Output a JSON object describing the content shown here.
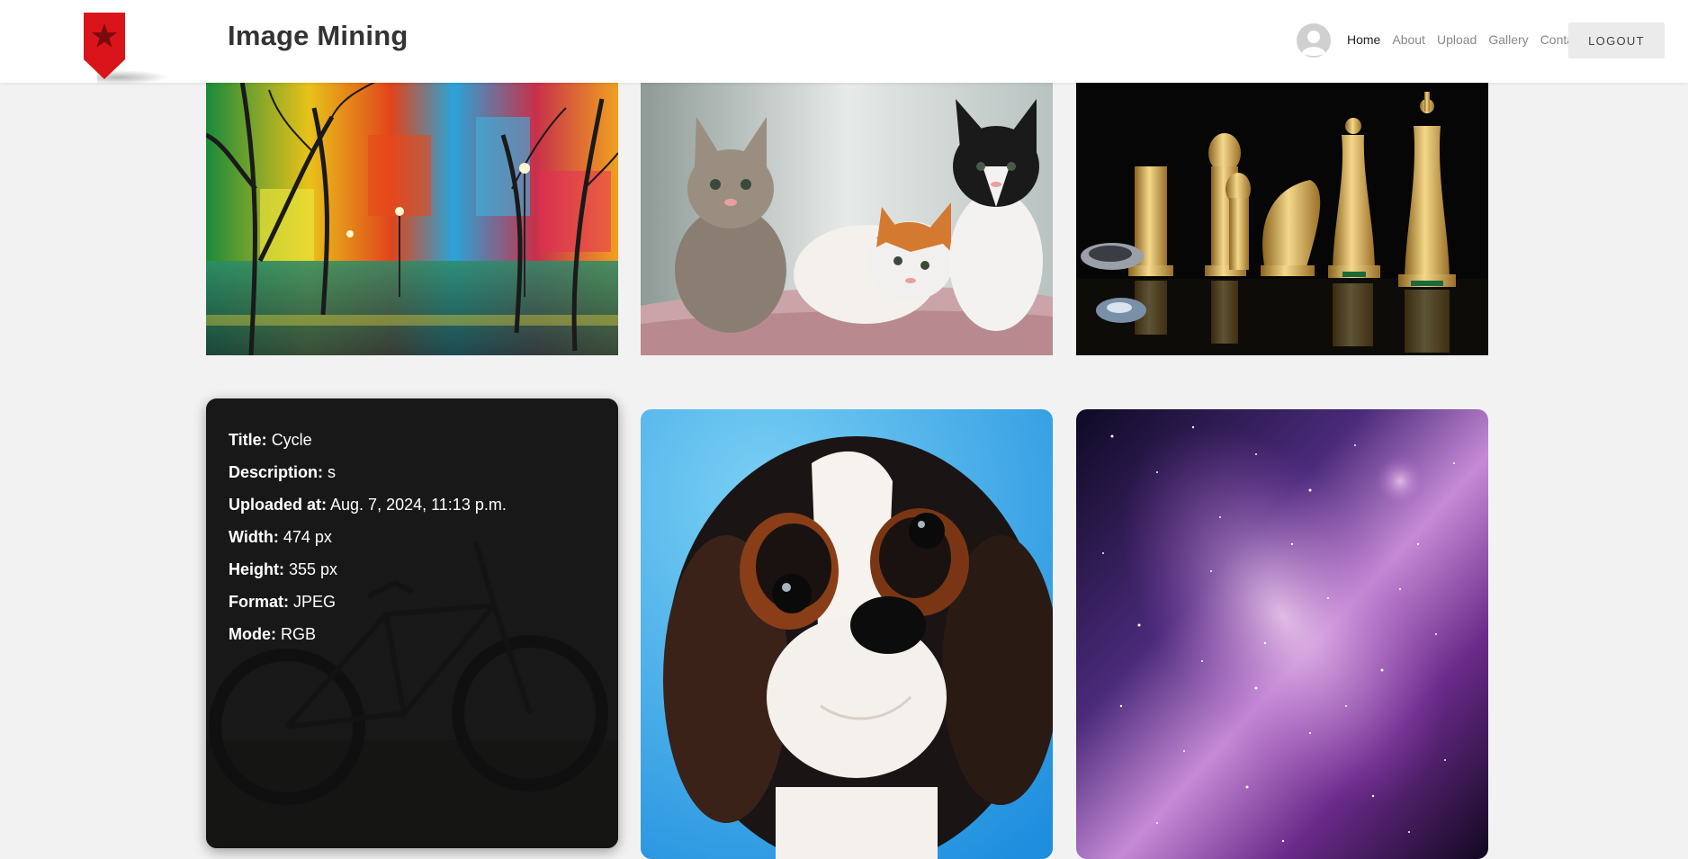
{
  "header": {
    "title": "Image Mining",
    "logo_icon": "bookmark-star-icon",
    "avatar_icon": "user-avatar-icon",
    "nav": [
      {
        "label": "Home",
        "active": true
      },
      {
        "label": "About",
        "active": false
      },
      {
        "label": "Upload",
        "active": false
      },
      {
        "label": "Gallery",
        "active": false
      },
      {
        "label": "Contact",
        "active": false
      }
    ],
    "logout_label": "LOGOUT"
  },
  "gallery": {
    "images": [
      {
        "subject": "colorful painted forest with street lamps"
      },
      {
        "subject": "three kittens"
      },
      {
        "subject": "golden chess pieces"
      },
      {
        "subject": "bicycle",
        "selected": true
      },
      {
        "subject": "puppy"
      },
      {
        "subject": "purple galaxy"
      }
    ],
    "details": {
      "title_label": "Title:",
      "title": "Cycle",
      "description_label": "Description:",
      "description": "s",
      "uploaded_label": "Uploaded at:",
      "uploaded": "Aug. 7, 2024, 11:13 p.m.",
      "width_label": "Width:",
      "width": "474 px",
      "height_label": "Height:",
      "height": "355 px",
      "format_label": "Format:",
      "format": "JPEG",
      "mode_label": "Mode:",
      "mode": "RGB"
    }
  },
  "colors": {
    "accent_red": "#d9141a",
    "background": "#f2f2f2",
    "header_bg": "#ffffff"
  }
}
